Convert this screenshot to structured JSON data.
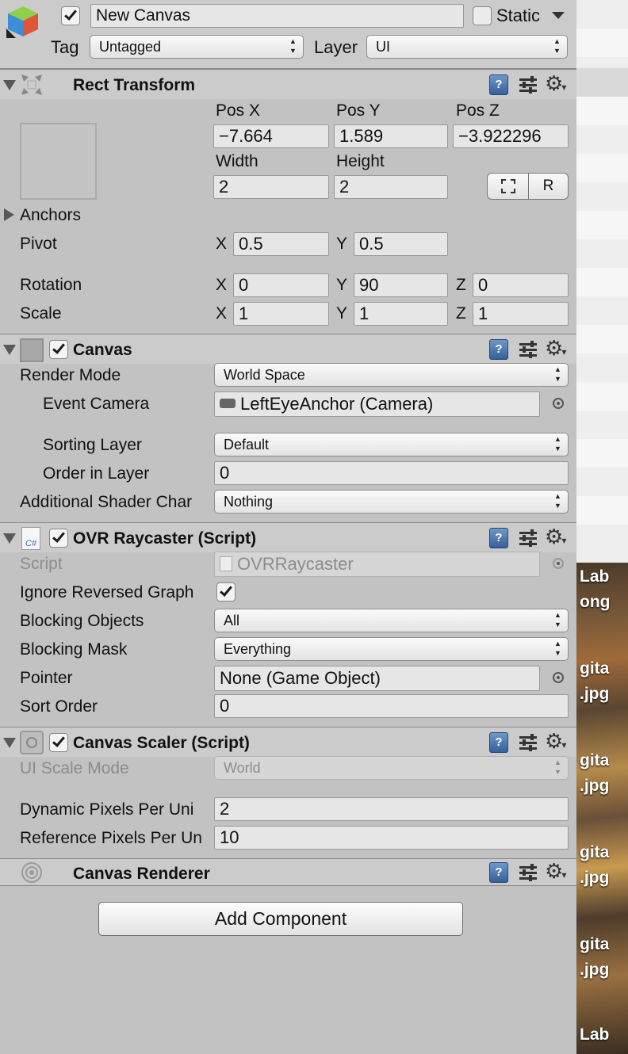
{
  "gameobject": {
    "name": "New Canvas",
    "static_label": "Static",
    "tag_label": "Tag",
    "tag_value": "Untagged",
    "layer_label": "Layer",
    "layer_value": "UI"
  },
  "rect_transform": {
    "title": "Rect Transform",
    "pos_x_label": "Pos X",
    "pos_y_label": "Pos Y",
    "pos_z_label": "Pos Z",
    "pos_x": "−7.664",
    "pos_y": "1.589",
    "pos_z": "−3.922296",
    "width_label": "Width",
    "height_label": "Height",
    "width": "2",
    "height": "2",
    "r_button": "R",
    "anchors_label": "Anchors",
    "pivot_label": "Pivot",
    "pivot_x": "0.5",
    "pivot_y": "0.5",
    "rotation_label": "Rotation",
    "rot_x": "0",
    "rot_y": "90",
    "rot_z": "0",
    "scale_label": "Scale",
    "scale_x": "1",
    "scale_y": "1",
    "scale_z": "1",
    "x": "X",
    "y": "Y",
    "z": "Z"
  },
  "canvas": {
    "title": "Canvas",
    "render_mode_label": "Render Mode",
    "render_mode": "World Space",
    "event_camera_label": "Event Camera",
    "event_camera": "LeftEyeAnchor (Camera)",
    "sorting_layer_label": "Sorting Layer",
    "sorting_layer": "Default",
    "order_label": "Order in Layer",
    "order": "0",
    "shader_label": "Additional Shader Char",
    "shader": "Nothing"
  },
  "ovr": {
    "title": "OVR Raycaster (Script)",
    "script_label": "Script",
    "script": "OVRRaycaster",
    "ignore_label": "Ignore Reversed Graph",
    "blocking_objects_label": "Blocking Objects",
    "blocking_objects": "All",
    "blocking_mask_label": "Blocking Mask",
    "blocking_mask": "Everything",
    "pointer_label": "Pointer",
    "pointer": "None (Game Object)",
    "sort_order_label": "Sort Order",
    "sort_order": "0"
  },
  "scaler": {
    "title": "Canvas Scaler (Script)",
    "ui_scale_label": "UI Scale Mode",
    "ui_scale": "World",
    "dynamic_label": "Dynamic Pixels Per Uni",
    "dynamic": "2",
    "reference_label": "Reference Pixels Per Un",
    "reference": "10"
  },
  "renderer": {
    "title": "Canvas Renderer"
  },
  "add_component": "Add Component",
  "icons": {
    "help": "?",
    "csharp": "C#"
  },
  "background_files": [
    "Lab",
    "ong",
    "gita",
    ".jpg",
    "gita",
    ".jpg",
    "gita",
    ".jpg",
    "gita",
    ".jpg",
    "Lab"
  ]
}
